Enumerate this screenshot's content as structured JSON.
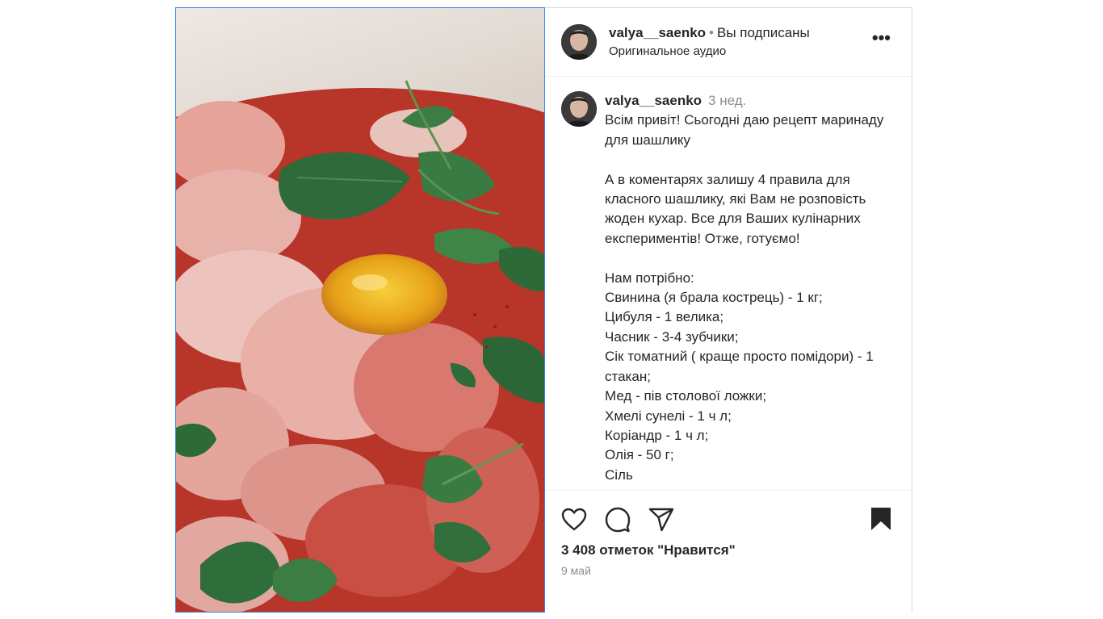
{
  "header": {
    "username": "valya__saenko",
    "separator": "•",
    "follow_status": "Вы подписаны",
    "audio": "Оригинальное аудио",
    "more_label": "•••"
  },
  "caption": {
    "username": "valya__saenko",
    "time": "3 нед.",
    "text": "Всім привіт! Сьогодні даю рецепт маринаду для шашлику\n\nА в коментарях залишу 4 правила для класного шашлику, які Вам не розповість жоден кухар. Все для Ваших кулінарних експериментів! Отже, готуємо!\n\nНам потрібно:\nСвинина (я брала кострець) - 1 кг;\nЦибуля - 1 велика;\nЧасник - 3-4 зубчики;\nСік томатний ( краще просто помідори) - 1 стакан;\nМед - пів столової ложки;\nХмелі сунелі - 1 ч л;\nКоріандр - 1 ч л;\nОлія - 50 г;\nСіль"
  },
  "footer": {
    "likes": "3 408 отметок \"Нравится\"",
    "date": "9 май"
  },
  "icons": {
    "like": "heart-icon",
    "comment": "comment-icon",
    "share": "paper-plane-icon",
    "save": "bookmark-icon",
    "more": "more-options-icon"
  },
  "colors": {
    "text": "#262626",
    "secondary": "#8e8e8e",
    "border": "#dbdbdb",
    "media_outline": "#3b82f6"
  }
}
